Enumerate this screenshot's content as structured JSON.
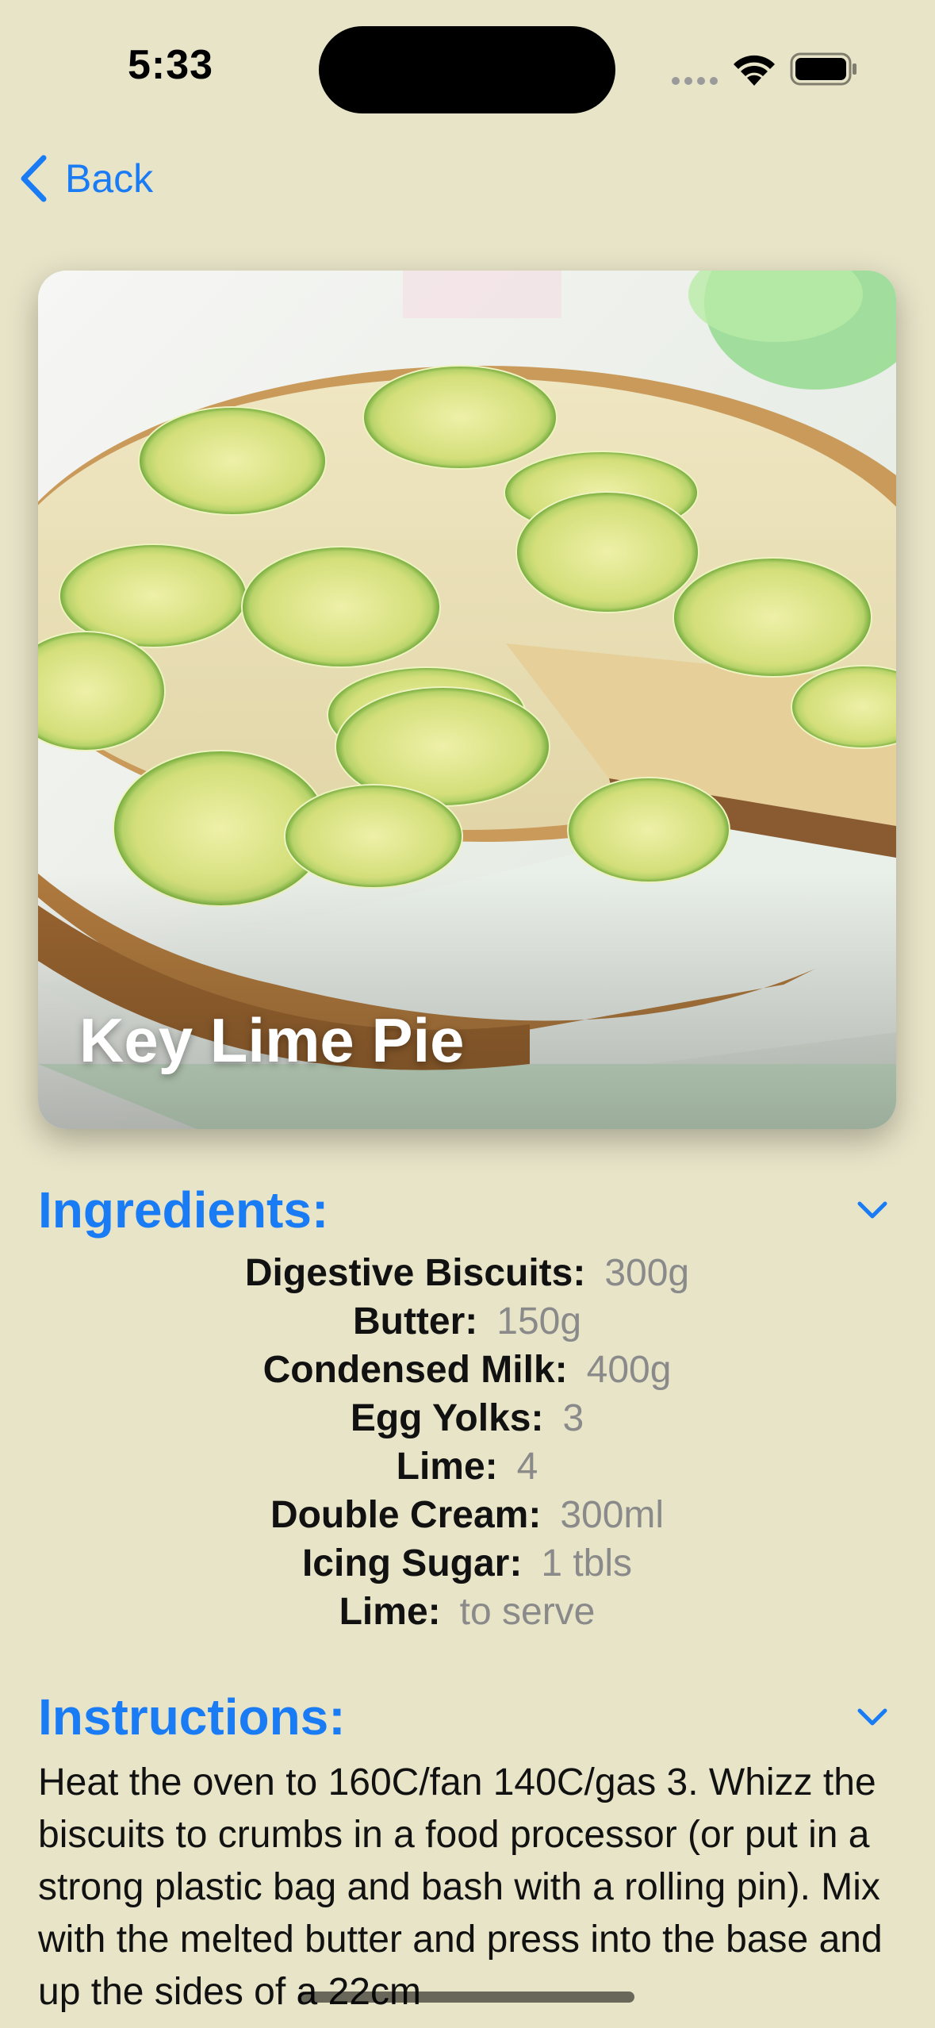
{
  "status_bar": {
    "time": "5:33"
  },
  "nav": {
    "back_label": "Back"
  },
  "hero": {
    "title": "Key Lime Pie"
  },
  "ingredients": {
    "title": "Ingredients:",
    "items": [
      {
        "name": "Digestive Biscuits:",
        "qty": "300g"
      },
      {
        "name": "Butter:",
        "qty": "150g"
      },
      {
        "name": "Condensed Milk:",
        "qty": "400g"
      },
      {
        "name": "Egg Yolks:",
        "qty": "3"
      },
      {
        "name": "Lime:",
        "qty": "4"
      },
      {
        "name": "Double Cream:",
        "qty": "300ml"
      },
      {
        "name": "Icing Sugar:",
        "qty": "1 tbls"
      },
      {
        "name": "Lime:",
        "qty": "to serve"
      }
    ]
  },
  "instructions": {
    "title": "Instructions:",
    "text": "Heat the oven to 160C/fan 140C/gas 3. Whizz the biscuits to crumbs in a food processor (or put in a strong plastic bag and bash with a rolling pin). Mix with the melted butter and press into the base and up the sides of a 22cm"
  },
  "colors": {
    "background": "#e8e4c8",
    "accent": "#1a7cf5",
    "quantity_text": "#8a8a8a"
  },
  "icons": {
    "back": "chevron-left-icon",
    "expand": "chevron-down-icon"
  }
}
